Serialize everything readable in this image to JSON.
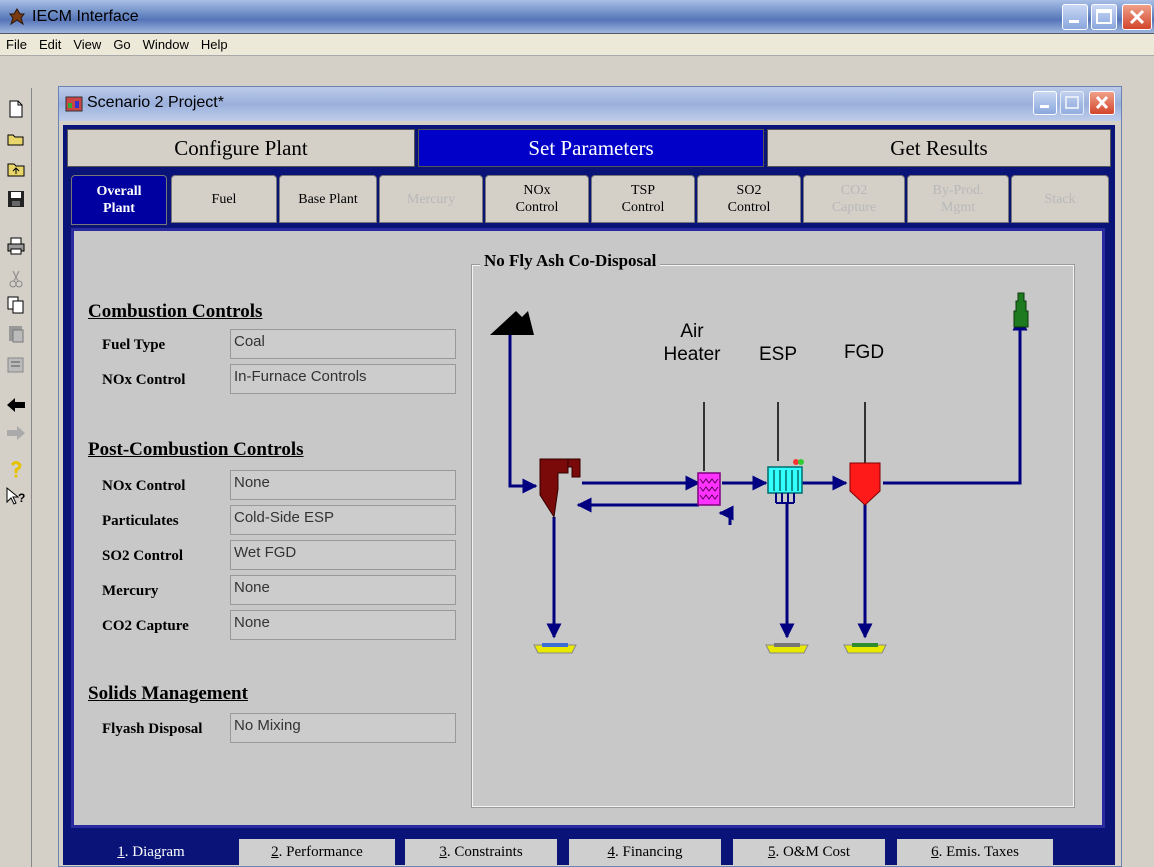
{
  "window": {
    "title": "IECM Interface"
  },
  "menu": [
    "File",
    "Edit",
    "View",
    "Go",
    "Window",
    "Help"
  ],
  "toolbar_icons": [
    "new-icon",
    "open-icon",
    "up-folder-icon",
    "save-icon",
    "print-icon",
    "cut-icon",
    "copy-icon",
    "paste-icon",
    "properties-icon",
    "back-icon",
    "forward-icon",
    "help-icon",
    "context-help-icon"
  ],
  "project": {
    "title": "Scenario 2 Project*"
  },
  "main_tabs": [
    {
      "label": "Configure Plant",
      "active": false
    },
    {
      "label": "Set Parameters",
      "active": true
    },
    {
      "label": "Get Results",
      "active": false
    }
  ],
  "sub_tabs": [
    {
      "line1": "Overall",
      "line2": "Plant",
      "active": true,
      "enabled": true
    },
    {
      "line1": "Fuel",
      "line2": "",
      "active": false,
      "enabled": true
    },
    {
      "line1": "Base Plant",
      "line2": "",
      "active": false,
      "enabled": true
    },
    {
      "line1": "Mercury",
      "line2": "",
      "active": false,
      "enabled": false
    },
    {
      "line1": "NOx",
      "line2": "Control",
      "active": false,
      "enabled": true
    },
    {
      "line1": "TSP",
      "line2": "Control",
      "active": false,
      "enabled": true
    },
    {
      "line1": "SO2",
      "line2": "Control",
      "active": false,
      "enabled": true
    },
    {
      "line1": "CO2",
      "line2": "Capture",
      "active": false,
      "enabled": false
    },
    {
      "line1": "By-Prod.",
      "line2": "Mgmt",
      "active": false,
      "enabled": false
    },
    {
      "line1": "Stack",
      "line2": "",
      "active": false,
      "enabled": false
    }
  ],
  "combustion": {
    "title": "Combustion Controls",
    "fields": [
      {
        "label": "Fuel Type",
        "value": "Coal"
      },
      {
        "label": "NOx Control",
        "value": "In-Furnace Controls"
      }
    ]
  },
  "post_combustion": {
    "title": "Post-Combustion Controls",
    "fields": [
      {
        "label": "NOx Control",
        "value": "None"
      },
      {
        "label": "Particulates",
        "value": "Cold-Side ESP"
      },
      {
        "label": "SO2 Control",
        "value": "Wet FGD"
      },
      {
        "label": "Mercury",
        "value": "None"
      },
      {
        "label": "CO2 Capture",
        "value": "None"
      }
    ]
  },
  "solids": {
    "title": "Solids Management",
    "fields": [
      {
        "label": "Flyash Disposal",
        "value": "No Mixing"
      }
    ]
  },
  "diagram": {
    "title": "No Fly Ash Co-Disposal",
    "labels": {
      "air_heater_1": "Air",
      "air_heater_2": "Heater",
      "esp": "ESP",
      "fgd": "FGD"
    },
    "colors": {
      "flow": "#000080",
      "boiler": "#7a0a0a",
      "air_heater": "#ff33ff",
      "esp": "#33ffff",
      "fgd": "#ff1a1a",
      "stack": "#1e7a1e",
      "coal": "#000000",
      "ash_pit": "#e8e800"
    }
  },
  "bottom_tabs": [
    {
      "key": "1",
      "label": ". Diagram",
      "active": true
    },
    {
      "key": "2",
      "label": ". Performance",
      "active": false
    },
    {
      "key": "3",
      "label": ". Constraints",
      "active": false
    },
    {
      "key": "4",
      "label": ". Financing",
      "active": false
    },
    {
      "key": "5",
      "label": ". O&M Cost",
      "active": false
    },
    {
      "key": "6",
      "label": ". Emis. Taxes",
      "active": false
    }
  ]
}
